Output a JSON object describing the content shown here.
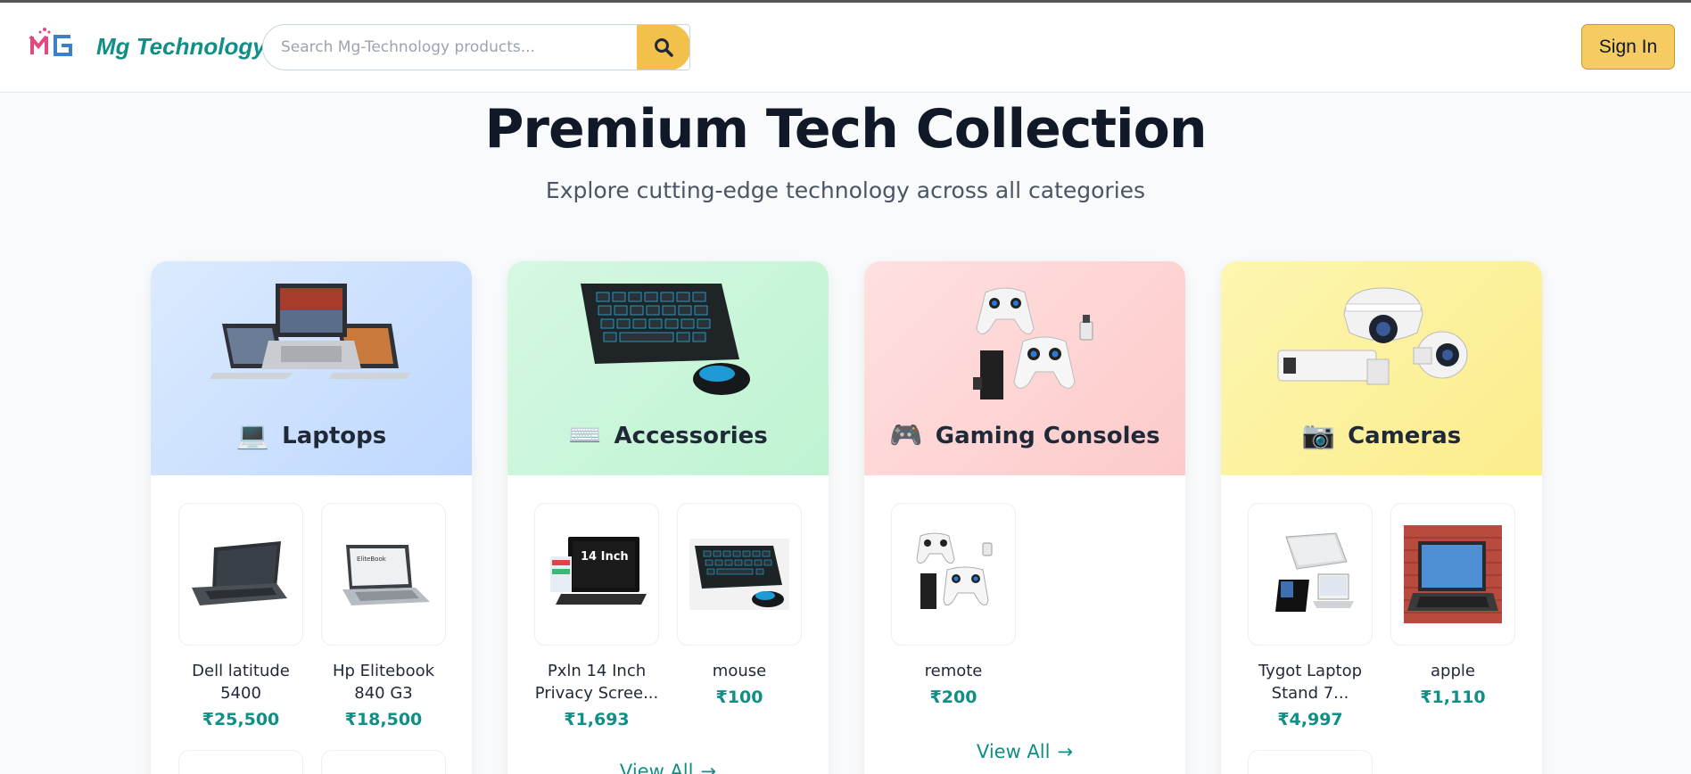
{
  "header": {
    "brand": "Mg Technology",
    "search_placeholder": "Search Mg-Technology products...",
    "search_icon": "search-icon",
    "signin_label": "Sign In"
  },
  "hero": {
    "title": "Premium Tech Collection",
    "subtitle": "Explore cutting-edge technology across all categories"
  },
  "colors": {
    "accent": "#0f8f86",
    "button": "#f6cb62",
    "laptops_bg": "#c7dcff",
    "accessories_bg": "#c5f5d6",
    "gaming_bg": "#fed3d3",
    "cameras_bg": "#fbf09c"
  },
  "categories": [
    {
      "title": "Laptops",
      "emoji": "💻",
      "products": [
        {
          "name": "Dell latitude 5400",
          "price": "₹25,500"
        },
        {
          "name": "Hp Elitebook 840 G3",
          "price": "₹18,500"
        }
      ]
    },
    {
      "title": "Accessories",
      "emoji": "⌨️",
      "products": [
        {
          "name": "Pxln 14 Inch Privacy Scree...",
          "price": "₹1,693"
        },
        {
          "name": "mouse",
          "price": "₹100"
        }
      ],
      "view_all": "View All"
    },
    {
      "title": "Gaming Consoles",
      "emoji": "🎮",
      "products": [
        {
          "name": "remote",
          "price": "₹200"
        }
      ],
      "view_all": "View All"
    },
    {
      "title": "Cameras",
      "emoji": "📷",
      "products": [
        {
          "name": "Tygot Laptop Stand 7...",
          "price": "₹4,997"
        },
        {
          "name": "apple",
          "price": "₹1,110"
        }
      ]
    }
  ],
  "product_thumb_text": "14 Inch"
}
